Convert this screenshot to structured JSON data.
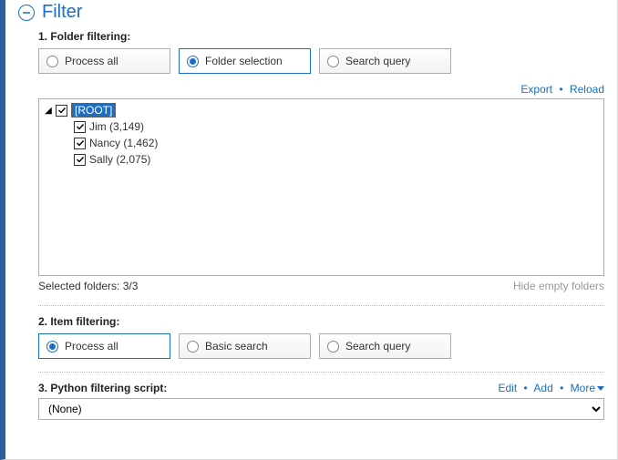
{
  "header": {
    "title": "Filter"
  },
  "section1": {
    "label": "1. Folder filtering:",
    "options": {
      "process_all": "Process all",
      "folder_selection": "Folder selection",
      "search_query": "Search query"
    },
    "links": {
      "export": "Export",
      "reload": "Reload"
    },
    "tree": {
      "root": "[ROOT]",
      "children": [
        {
          "label": "Jim (3,149)"
        },
        {
          "label": "Nancy (1,462)"
        },
        {
          "label": "Sally (2,075)"
        }
      ]
    },
    "status": "Selected folders: 3/3",
    "hide_empty": "Hide empty folders"
  },
  "section2": {
    "label": "2. Item filtering:",
    "options": {
      "process_all": "Process all",
      "basic_search": "Basic search",
      "search_query": "Search query"
    }
  },
  "section3": {
    "label": "3. Python filtering script:",
    "links": {
      "edit": "Edit",
      "add": "Add",
      "more": "More"
    },
    "select_value": "(None)"
  }
}
